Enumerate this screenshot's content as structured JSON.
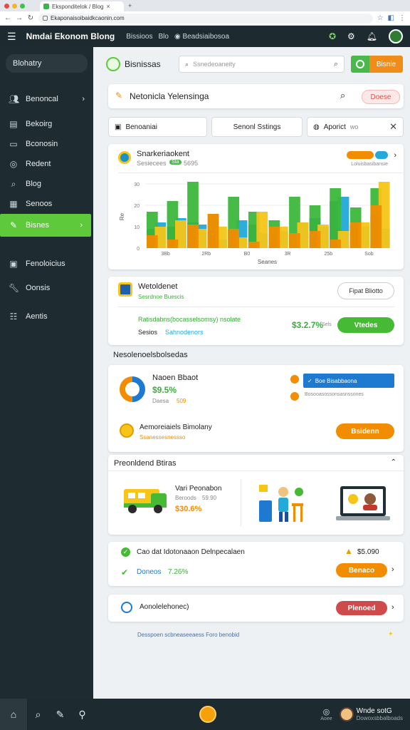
{
  "browser": {
    "tab_title": "Eksponditelok / Blog",
    "url": "Ekaponaisoibaidkcaonin.com",
    "colors": {
      "close": "#e84a3f",
      "min": "#f5b52b",
      "max": "#42c14a"
    }
  },
  "appbar": {
    "title": "Nmdai Ekonom Blong",
    "links": [
      "Bissioos",
      "Blo",
      "Beadsiaibosoa"
    ]
  },
  "sidebar": {
    "brand": "Blohatry",
    "items": [
      {
        "label": "Benoncal",
        "icon": "users-icon",
        "chevron": true
      },
      {
        "label": "Bekoirg",
        "icon": "chart-icon"
      },
      {
        "label": "Bconosin",
        "icon": "document-icon"
      },
      {
        "label": "Redent",
        "icon": "eye-icon"
      },
      {
        "label": "Blog",
        "icon": "search-icon"
      },
      {
        "label": "Senoos",
        "icon": "calendar-icon"
      },
      {
        "label": "Bisnes",
        "icon": "leaf-icon",
        "active": true
      },
      {
        "label": "Fenoloicius",
        "icon": "folder-icon"
      },
      {
        "label": "Oonsis",
        "icon": "wrench-icon"
      },
      {
        "label": "Aentis",
        "icon": "grid-icon"
      }
    ]
  },
  "main": {
    "brand_label": "Bisnissas",
    "search_placeholder": "Ssnedeoaneity",
    "primary_button": "Bisnie",
    "hero_search_placeholder": "Netonicla Yelensinga",
    "hero_button": "Doese",
    "filters": [
      "Benoaniai",
      "Senonl Sstings",
      "Aporict"
    ],
    "filter_tag": "wo",
    "chart_card": {
      "title": "Snarkeriaokent",
      "subtitle": "Sesiecees",
      "badge": "Sta",
      "badge_value": "5695",
      "legend_sub": "Loluisbasibansie"
    },
    "biz_card": {
      "title": "Wetoldenet",
      "subtitle": "Sesrdnoe Buescis",
      "button_outline": "Fipat Bliotto",
      "row1": "Ratisdabns(bocasselsomsy) nsolate",
      "row2_prefix": "Sesios",
      "row2_value": "Sahnodenors",
      "percent": "$3.2.7%",
      "percent_suffix": "Sels",
      "button_green": "Vtedes"
    },
    "section_title": "Nesolenoelsbolsedas",
    "donut_card": {
      "title": "Naoen Bbaot",
      "value": "$9.5%",
      "sub": "Daesa",
      "sub_value": "509",
      "select_label": "Boe Bisabbaona",
      "select_sub": "Bosooasossonsasnssones",
      "row_title": "Aemoreiaiels Bimolany",
      "row_sub": "Ssanessesnessso",
      "orange_button": "Bsidenn"
    },
    "promo_section": {
      "title": "Preonldend Btiras",
      "truck_title": "Vari Peonabon",
      "truck_sub": "Beroods",
      "truck_sub_value": "59.90",
      "truck_value": "$30.6%"
    },
    "row_card": {
      "line1": "Cao dat Idotonaaon Delnpecalaen",
      "price": "$5.090",
      "line2_label": "Doneos",
      "line2_value": "7.26%",
      "button": "Benaco"
    },
    "last_card": {
      "label": "Aonolelehonec)",
      "button": "Plenoed"
    },
    "footer_note": "Desspoen scbneaseeaess Foro benobid"
  },
  "bottombar": {
    "user_name": "Wnde sotG",
    "user_sub": "Dowoxsbbalboads",
    "icon_label": "Aoee"
  },
  "chart_data": {
    "type": "bar",
    "categories": [
      "3Bb",
      "2Rb",
      "B0",
      "3R",
      "25b",
      "Sob"
    ],
    "series": [
      {
        "name": "navy",
        "color": "#1e4f9a",
        "values": [
          9,
          10,
          12,
          8,
          9,
          11,
          5,
          7,
          14,
          22,
          11,
          15
        ]
      },
      {
        "name": "blue",
        "color": "#22aad8",
        "values": [
          12,
          14,
          11,
          4,
          13,
          7,
          8,
          12,
          10,
          24,
          10,
          9
        ]
      },
      {
        "name": "green",
        "color": "#3cb83c",
        "values": [
          17,
          22,
          31,
          16,
          24,
          17,
          13,
          24,
          20,
          28,
          19,
          28
        ]
      },
      {
        "name": "yellow",
        "color": "#f5c518",
        "values": [
          10,
          13,
          9,
          10,
          5,
          17,
          10,
          12,
          11,
          8,
          12,
          31
        ]
      },
      {
        "name": "orange",
        "color": "#f28c00",
        "values": [
          6,
          4,
          11,
          16,
          9,
          3,
          10,
          7,
          8,
          4,
          12,
          20
        ]
      }
    ],
    "yticks": [
      "0",
      "10",
      "20",
      "30"
    ],
    "ylim": [
      0,
      32
    ],
    "xlabel": "Seanes",
    "ylabel": "Re"
  }
}
